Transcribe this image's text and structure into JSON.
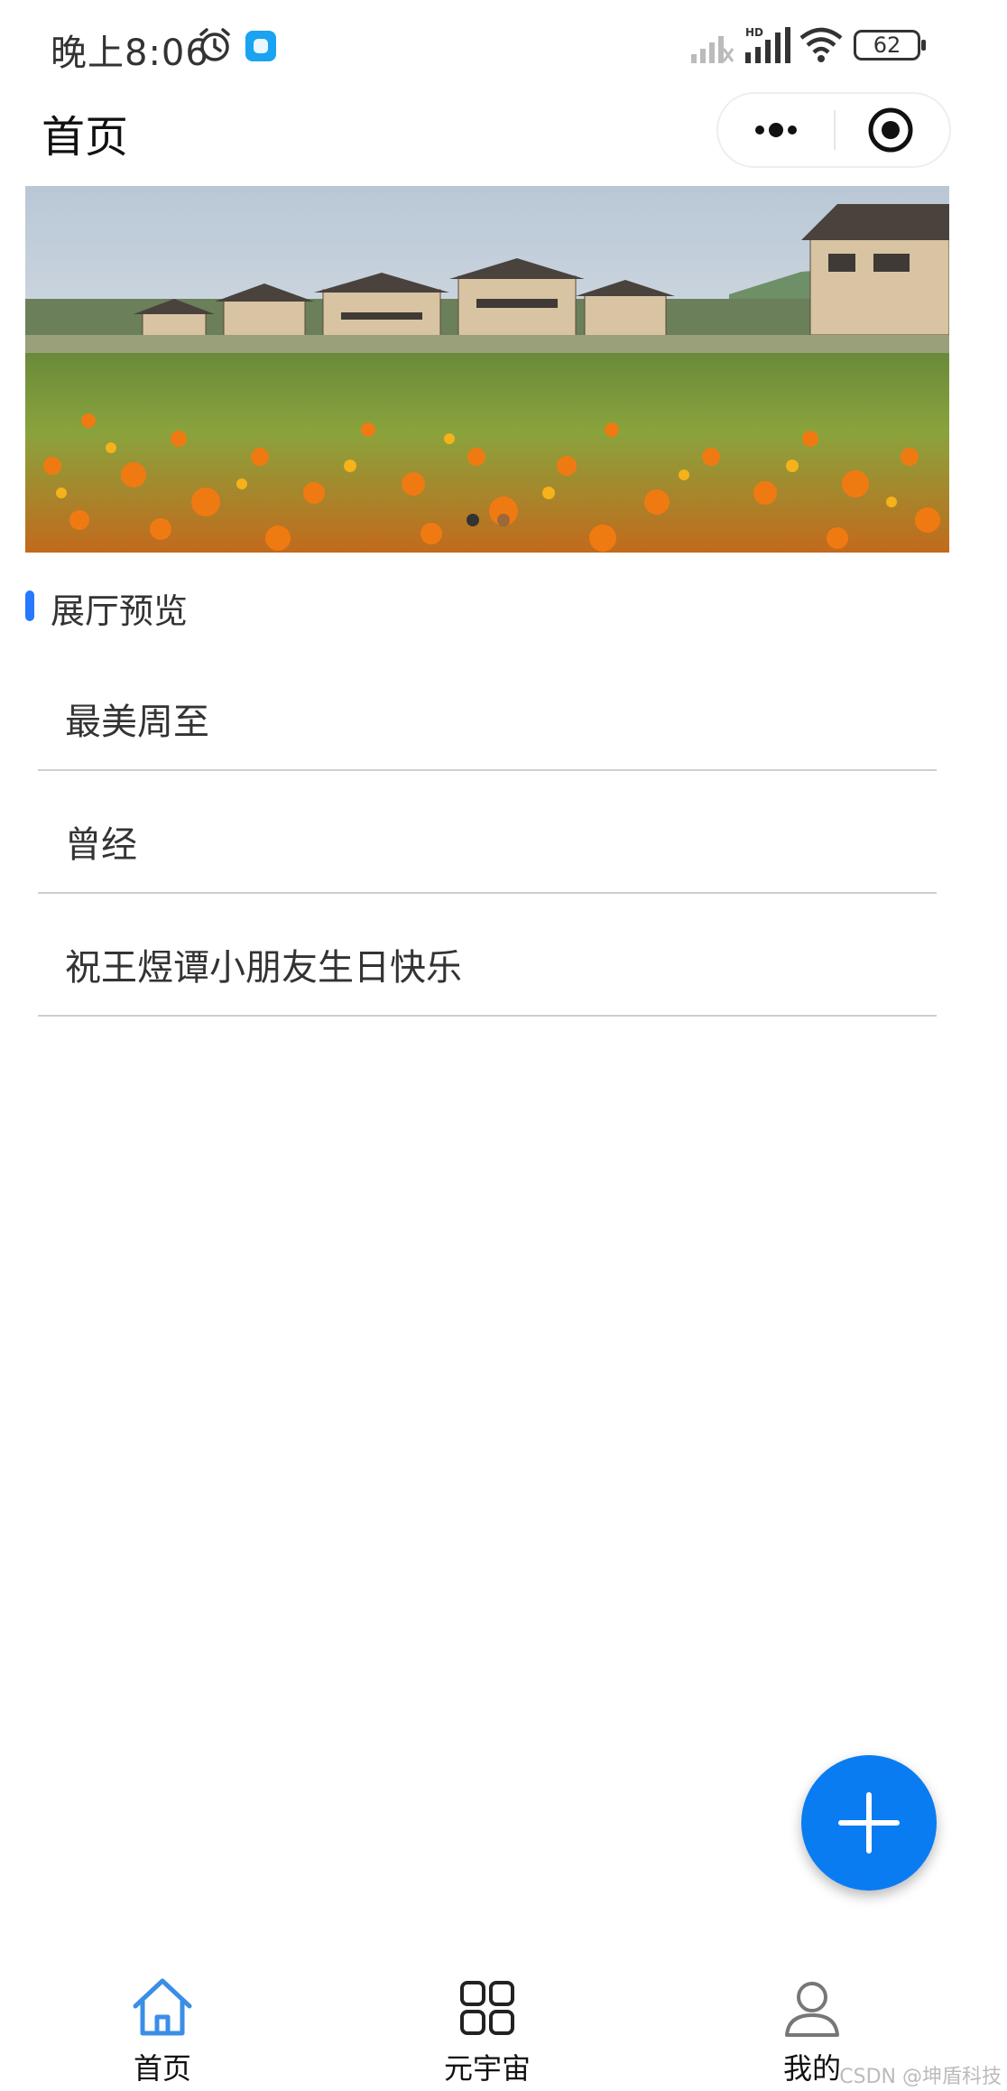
{
  "status_bar": {
    "time": "晚上8:06",
    "battery": "62",
    "icons": [
      "alarm-icon",
      "app-badge-icon",
      "signal-icon",
      "hd-signal-icon",
      "wifi-icon",
      "battery-icon"
    ]
  },
  "nav": {
    "title": "首页",
    "capsule": {
      "more_icon": "more-dots-icon",
      "close_icon": "target-close-icon"
    }
  },
  "banner": {
    "image": "village-flower-field-photo",
    "indicator_count": 2,
    "active_index": 0
  },
  "section": {
    "title": "展厅预览"
  },
  "halls": [
    {
      "name": "最美周至"
    },
    {
      "name": "曾经"
    },
    {
      "name": "祝王煜谭小朋友生日快乐"
    }
  ],
  "fab": {
    "icon": "plus-icon"
  },
  "tabbar": {
    "tabs": [
      {
        "label": "首页",
        "icon": "home-icon",
        "active": true
      },
      {
        "label": "元宇宙",
        "icon": "grid-icon",
        "active": false
      },
      {
        "label": "我的",
        "icon": "user-icon",
        "active": false
      }
    ]
  },
  "watermark": "CSDN @坤盾科技",
  "colors": {
    "accent": "#2878ff",
    "fab": "#0a7cf2",
    "home_active": "#3a8ee6"
  }
}
